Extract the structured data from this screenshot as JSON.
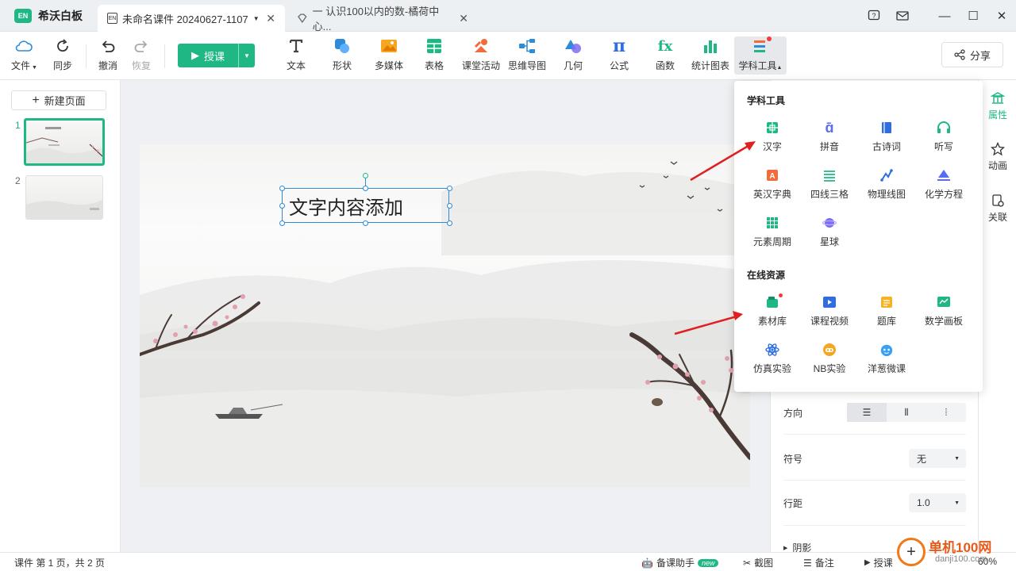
{
  "app": {
    "title": "希沃白板",
    "logo_text": "EN"
  },
  "tabs": [
    {
      "label": "未命名课件 20240627-1107",
      "icon": "courseware-icon",
      "active": true
    },
    {
      "label": "一 认识100以内的数-橘荷中心...",
      "icon": "diamond-icon",
      "active": false
    }
  ],
  "window_controls": [
    "help-icon",
    "mail-icon",
    "minimize-icon",
    "maximize-icon",
    "close-icon"
  ],
  "toolbar": {
    "file": "文件",
    "sync": "同步",
    "undo": "撤消",
    "redo": "恢复",
    "teach": "授课",
    "text": "文本",
    "shape": "形状",
    "media": "多媒体",
    "table": "表格",
    "activity": "课堂活动",
    "mindmap": "思维导图",
    "geometry": "几何",
    "formula": "公式",
    "function": "函数",
    "chart": "统计图表",
    "subject_tools": "学科工具",
    "share": "分享"
  },
  "sidebar": {
    "new_page": "新建页面",
    "pages": [
      {
        "num": "1",
        "selected": true
      },
      {
        "num": "2",
        "selected": false
      }
    ]
  },
  "canvas": {
    "text_box": "文字内容添加"
  },
  "dropdown": {
    "section1": "学科工具",
    "tools1": [
      "汉字",
      "拼音",
      "古诗词",
      "听写",
      "英汉字典",
      "四线三格",
      "物理线图",
      "化学方程",
      "元素周期",
      "星球"
    ],
    "section2": "在线资源",
    "tools2": [
      "素材库",
      "课程视频",
      "题库",
      "数学画板",
      "仿真实验",
      "NB实验",
      "洋葱微课"
    ]
  },
  "right_panel": {
    "direction_label": "方向",
    "symbol_label": "符号",
    "symbol_value": "无",
    "spacing_label": "行距",
    "spacing_value": "1.0",
    "shadow_label": "阴影"
  },
  "rail": {
    "properties": "属性",
    "animation": "动画",
    "link": "关联"
  },
  "statusbar": {
    "page_info": "课件 第 1 页，共 2 页",
    "assistant": "备课助手",
    "new_badge": "new",
    "screenshot": "截图",
    "notes": "备注",
    "teach": "授课",
    "zoom": "60%",
    "watermark": "单机100网",
    "watermark_url": "danji100.com"
  },
  "colors": {
    "accent": "#1fb884",
    "selection": "#2e8bd8",
    "arrow": "#e02020"
  }
}
